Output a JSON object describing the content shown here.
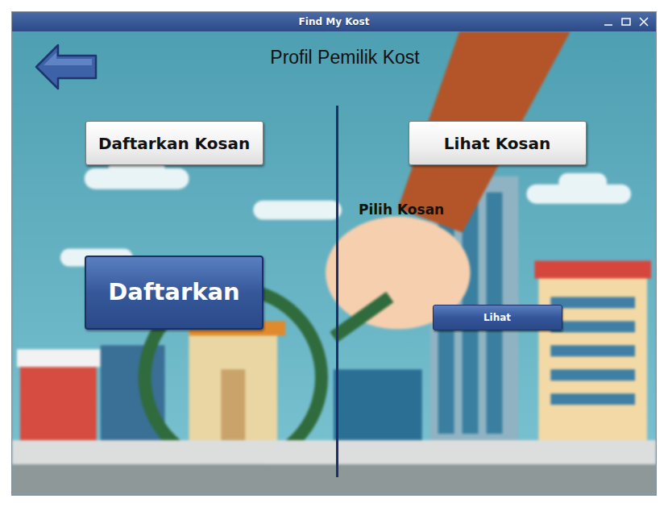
{
  "window": {
    "title": "Find My Kost"
  },
  "page": {
    "title": "Profil Pemilik Kost"
  },
  "register": {
    "heading": "Daftarkan Kosan",
    "button": "Daftarkan"
  },
  "view": {
    "heading": "Lihat Kosan",
    "label": "Pilih Kosan",
    "button": "Lihat"
  }
}
